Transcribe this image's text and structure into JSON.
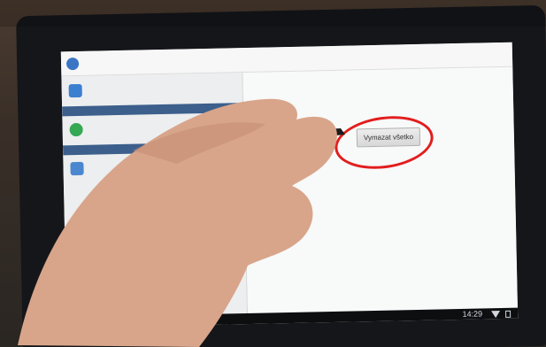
{
  "action_bar": {
    "title": ""
  },
  "sidebar": {
    "items": [
      {
        "label": "",
        "icon": "refresh-icon"
      },
      {
        "header": ""
      },
      {
        "label": "",
        "icon": "add-account-icon"
      },
      {
        "header": ""
      },
      {
        "label": "",
        "icon": "storage-icon"
      }
    ]
  },
  "content": {
    "section_title": "",
    "section_text": "",
    "clear_button": "Vymazat všetko"
  },
  "status_bar": {
    "time": "14:29"
  },
  "colors": {
    "highlight": "#e21d1d",
    "accent": "#3c5f8c",
    "screen": "#f4f5f5"
  }
}
